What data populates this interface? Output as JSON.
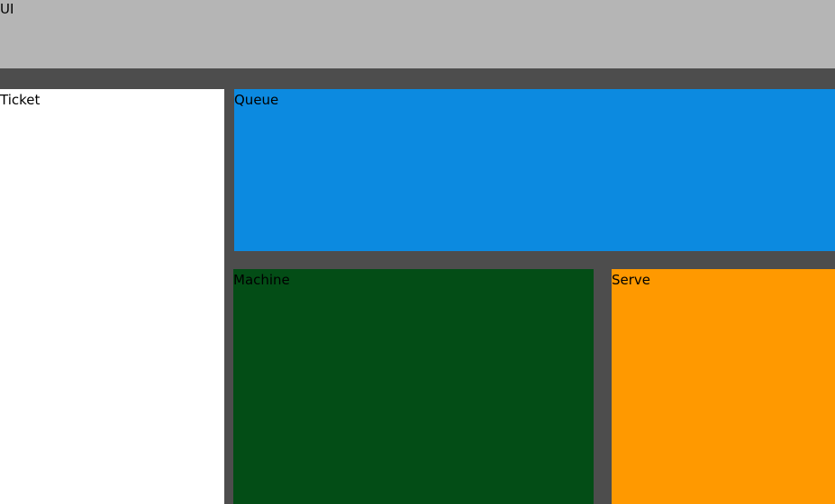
{
  "background_color": "#4d4d4d",
  "panels": {
    "ui": {
      "label": "UI",
      "color": "#b5b5b5"
    },
    "ticket": {
      "label": "Ticket",
      "color": "#ffffff"
    },
    "queue": {
      "label": "Queue",
      "color": "#0c8ae0"
    },
    "machine": {
      "label": "Machine",
      "color": "#034d16"
    },
    "serve": {
      "label": "Serve",
      "color": "#ff9900"
    }
  }
}
